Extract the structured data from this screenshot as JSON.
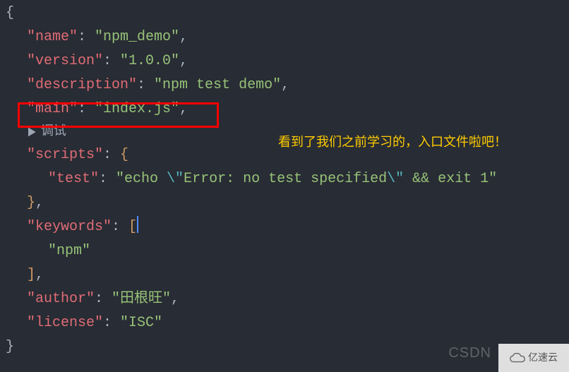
{
  "json": {
    "name_key": "\"name\"",
    "name_val": "\"npm_demo\"",
    "version_key": "\"version\"",
    "version_val": "\"1.0.0\"",
    "description_key": "\"description\"",
    "description_val": "\"npm test demo\"",
    "main_key": "\"main\"",
    "main_val": "\"index.js\"",
    "scripts_key": "\"scripts\"",
    "test_key": "\"test\"",
    "test_val_part1": "\"echo ",
    "test_esc1": "\\\"",
    "test_val_part2": "Error: no test specified",
    "test_esc2": "\\\"",
    "test_val_part3": " && exit 1\"",
    "keywords_key": "\"keywords\"",
    "keywords_item": "\"npm\"",
    "author_key": "\"author\"",
    "author_val": "\"田根旺\"",
    "license_key": "\"license\"",
    "license_val": "\"ISC\""
  },
  "debug": {
    "label": "调试"
  },
  "annotation": {
    "text": "看到了我们之前学习的，入口文件啦吧！"
  },
  "watermark": {
    "csdn": "CSDN",
    "yisu": "亿速云"
  },
  "symbols": {
    "colon": ": ",
    "comma": ",",
    "lbrace": "{",
    "rbrace": "}",
    "lbracket": "[",
    "rbracket": "]",
    "rbrace_comma": "},",
    "rbracket_comma": "],"
  }
}
